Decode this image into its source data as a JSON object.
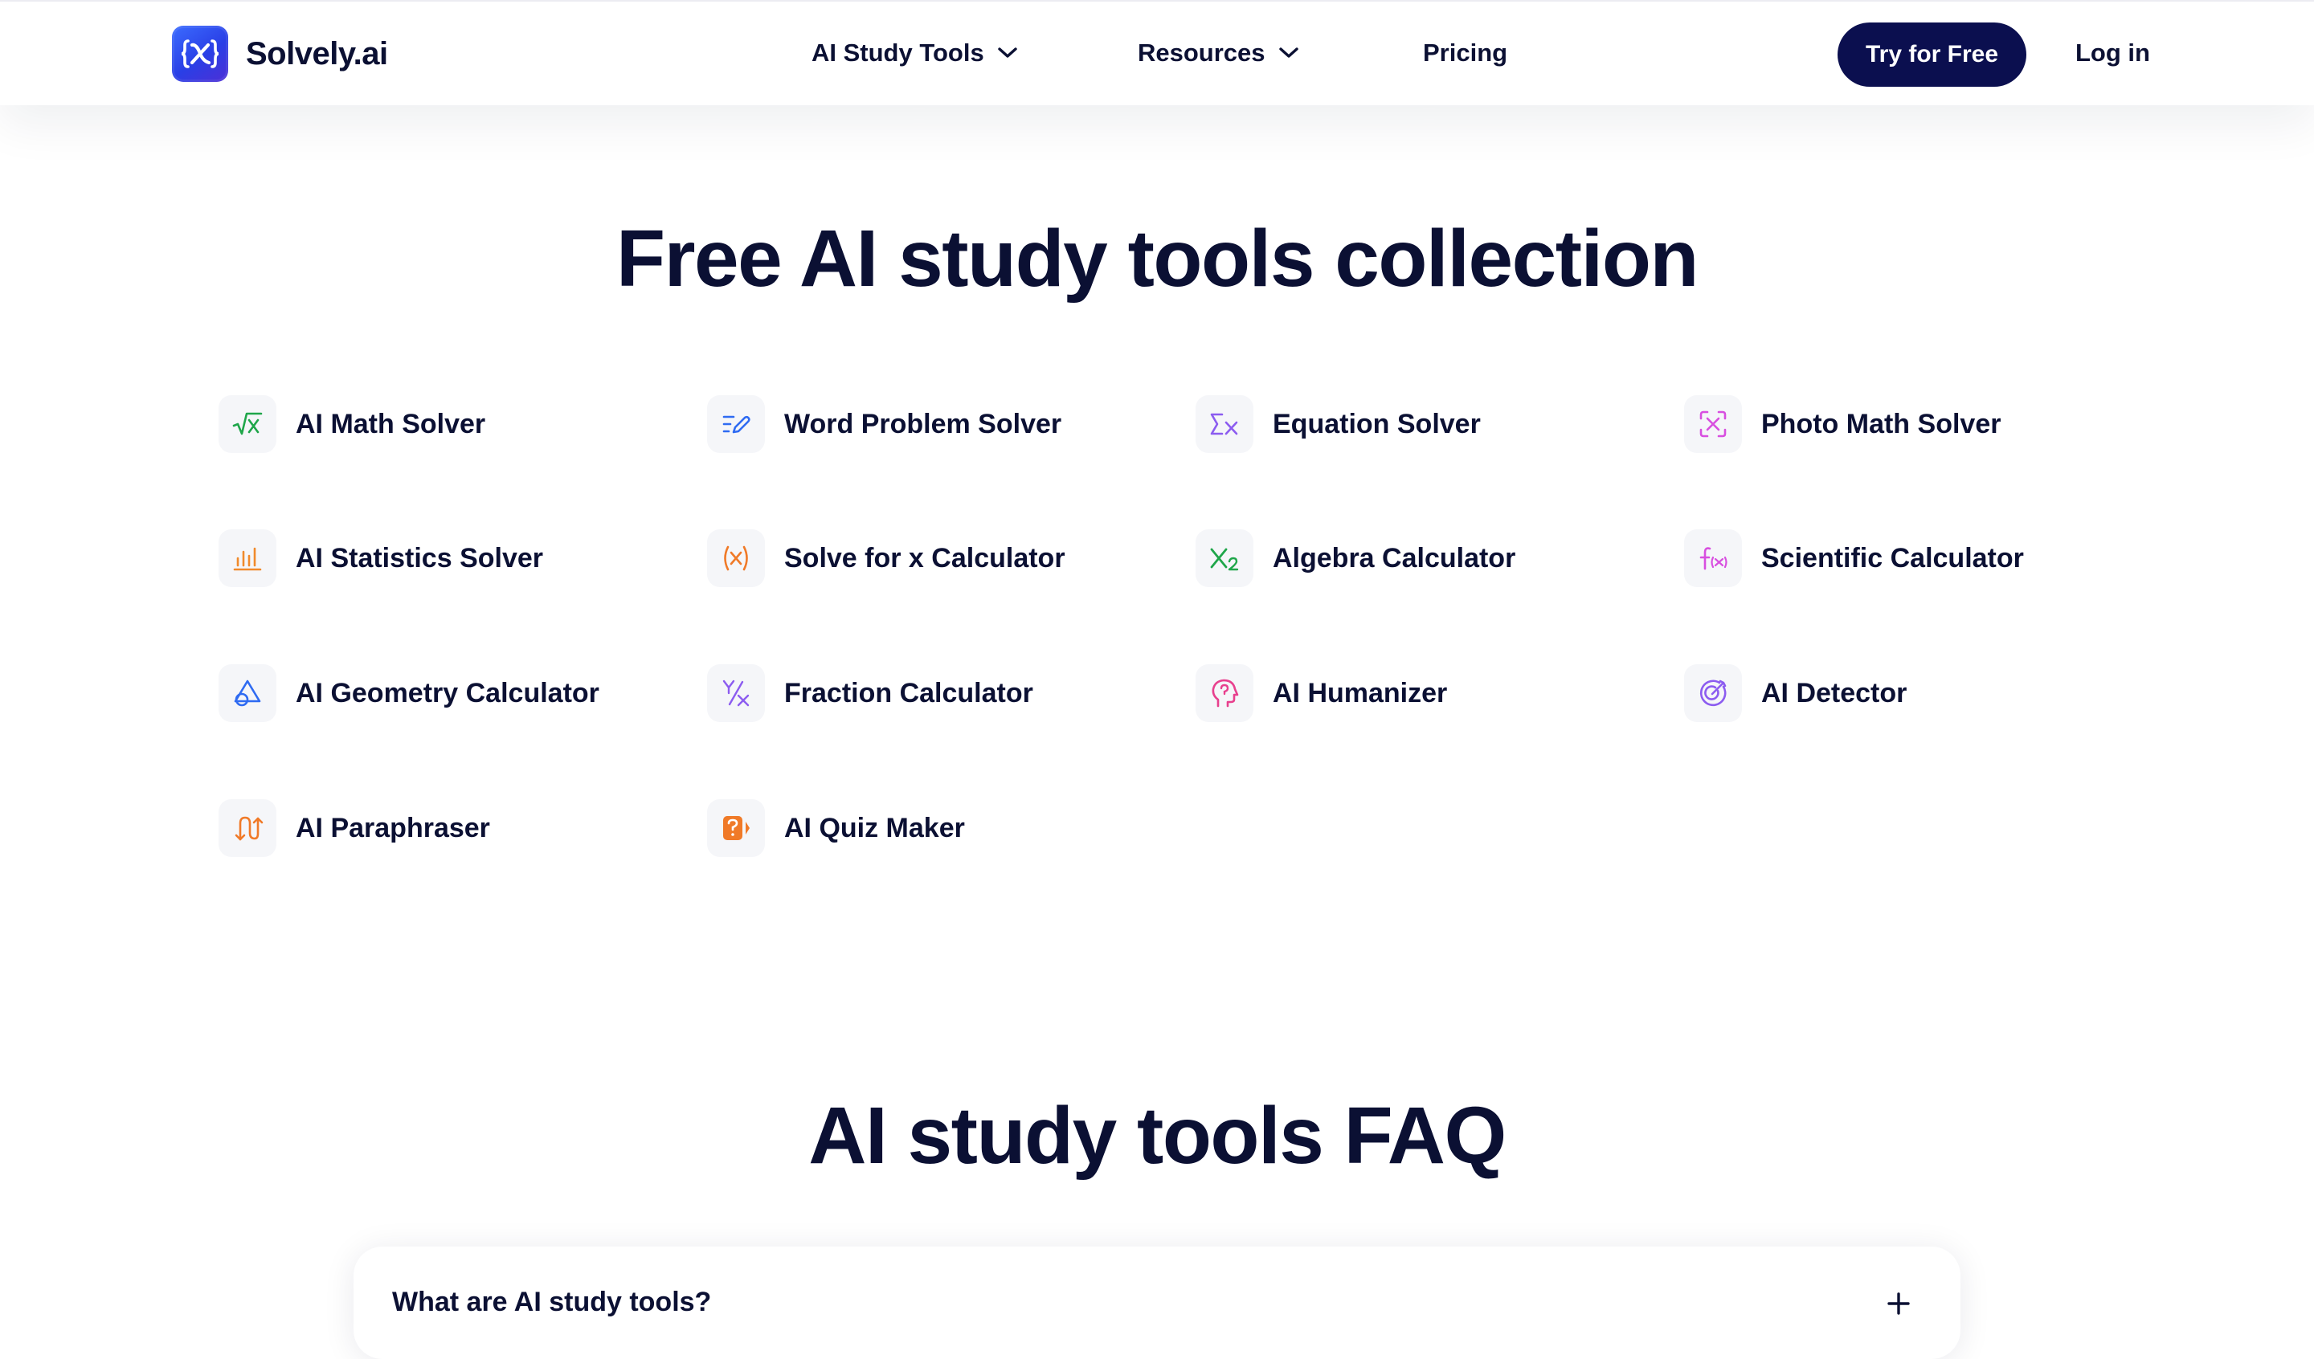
{
  "brand": {
    "name": "Solvely.ai",
    "accent": "#2f4bf0",
    "dark": "#0b0f4f"
  },
  "nav": {
    "items": [
      {
        "label": "AI Study Tools",
        "dropdown": true
      },
      {
        "label": "Resources",
        "dropdown": true
      },
      {
        "label": "Pricing",
        "dropdown": false
      }
    ],
    "cta_label": "Try for Free",
    "login_label": "Log in"
  },
  "tools_section": {
    "title": "Free AI study tools collection",
    "tools": [
      {
        "label": "AI Math Solver",
        "icon": "sqrt-x-icon",
        "color": "#1fa64a"
      },
      {
        "label": "Word Problem Solver",
        "icon": "pencil-list-icon",
        "color": "#2f6bf2"
      },
      {
        "label": "Equation Solver",
        "icon": "sigma-x-icon",
        "color": "#8c5cf0"
      },
      {
        "label": "Photo Math Solver",
        "icon": "scan-x-icon",
        "color": "#d84fe0"
      },
      {
        "label": "AI Statistics Solver",
        "icon": "bar-chart-icon",
        "color": "#f08a2c"
      },
      {
        "label": "Solve for x Calculator",
        "icon": "paren-x-icon",
        "color": "#f07a28"
      },
      {
        "label": "Algebra Calculator",
        "icon": "x-subscript-icon",
        "color": "#1fa64a"
      },
      {
        "label": "Scientific Calculator",
        "icon": "function-fx-icon",
        "color": "#d84fe0"
      },
      {
        "label": "AI Geometry Calculator",
        "icon": "geometry-shapes-icon",
        "color": "#2f6bf2"
      },
      {
        "label": "Fraction Calculator",
        "icon": "fraction-icon",
        "color": "#8c5cf0"
      },
      {
        "label": "AI Humanizer",
        "icon": "human-head-icon",
        "color": "#e8408e"
      },
      {
        "label": "AI Detector",
        "icon": "target-detector-icon",
        "color": "#8c5cf0"
      },
      {
        "label": "AI Paraphraser",
        "icon": "paraphrase-arrows-icon",
        "color": "#f07a28"
      },
      {
        "label": "AI Quiz Maker",
        "icon": "quiz-question-icon",
        "color": "#f07a28"
      }
    ]
  },
  "faq_section": {
    "title": "AI study tools FAQ",
    "items": [
      {
        "question": "What are AI study tools?"
      }
    ]
  }
}
